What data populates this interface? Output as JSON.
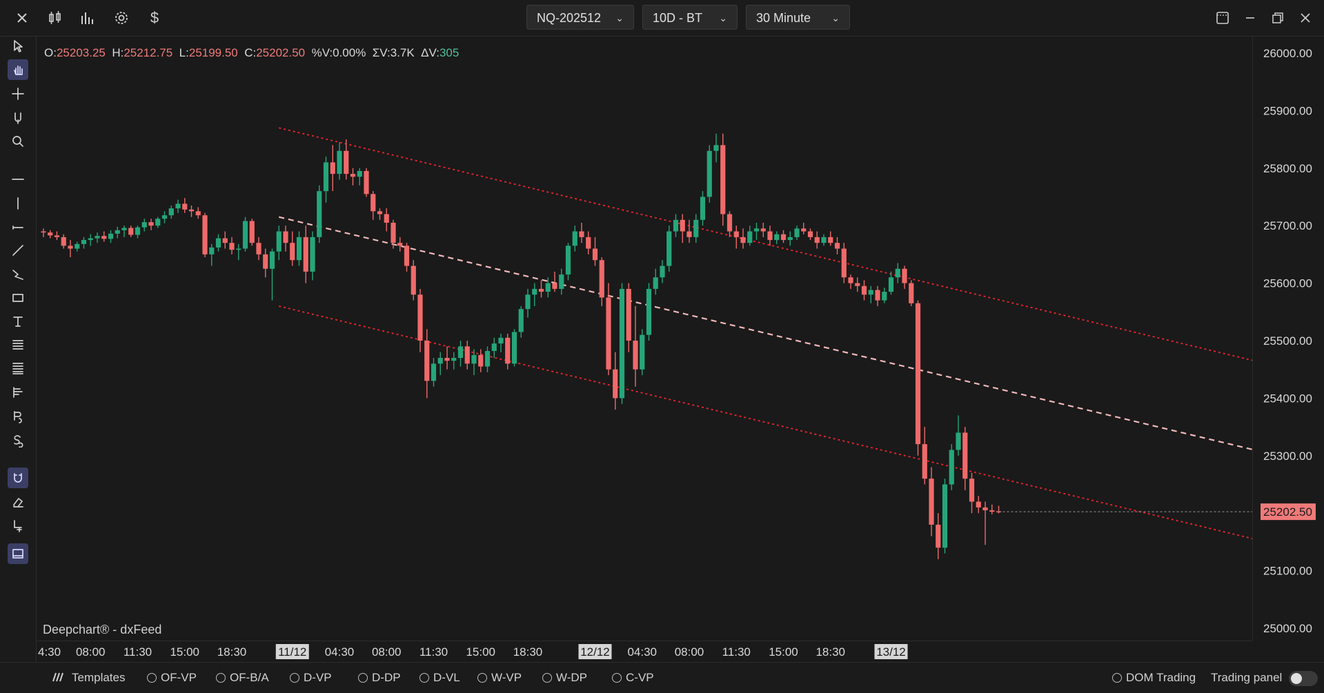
{
  "toolbar": {
    "symbol": "NQ-202512",
    "range": "10D - BT",
    "interval": "30 Minute",
    "icons": [
      "close-icon",
      "candles-icon",
      "bars-icon",
      "gear-icon",
      "dollar-icon"
    ],
    "window_icons": [
      "layout-icon",
      "minimize-icon",
      "restore-icon",
      "close-window-icon"
    ]
  },
  "ohlc": {
    "o_label": "O:",
    "o": "25203.25",
    "h_label": "H:",
    "h": "25212.75",
    "l_label": "L:",
    "l": "25199.50",
    "c_label": "C:",
    "c": "25202.50",
    "pv_label": "%V:",
    "pv": "0.00%",
    "sv_label": "ΣV:",
    "sv": "3.7K",
    "dv_label": "ΔV:",
    "dv": "305"
  },
  "watermark": "Deepchart® - dxFeed",
  "colors": {
    "up": "#26a67a",
    "down": "#f06a6a",
    "channel": "#e0242c",
    "midline": "#f2b8b8",
    "price_tag_bg": "#f07a7a",
    "active_tool": "#3b3f66"
  },
  "left_tools": [
    "cursor-icon",
    "hand-icon",
    "crosshair-icon",
    "magnet-cursor-icon",
    "zoom-icon",
    "horizontal-line-icon",
    "vertical-line-icon",
    "ray-icon",
    "trend-line-icon",
    "path-icon",
    "rectangle-icon",
    "text-icon",
    "fib-icon",
    "lines-icon",
    "volume-profile-icon",
    "buy-sell-icon",
    "session-icon",
    "magnet-icon",
    "eraser-icon",
    "add-indicator-icon",
    "panel-icon"
  ],
  "bottom": {
    "templates": "Templates",
    "studies": [
      "OF-VP",
      "OF-B/A",
      "D-VP",
      "D-DP",
      "D-VL",
      "W-VP",
      "W-DP",
      "C-VP"
    ],
    "dom_trading": "DOM Trading",
    "trading_panel": "Trading panel"
  },
  "chart_data": {
    "type": "candlestick",
    "ylim": [
      24950,
      26050
    ],
    "y_ticks": [
      "26000.00",
      "25900.00",
      "25800.00",
      "25700.00",
      "25600.00",
      "25500.00",
      "25400.00",
      "25300.00",
      "25200.00",
      "25100.00",
      "25000.00"
    ],
    "y_tick_values": [
      26000,
      25900,
      25800,
      25700,
      25600,
      25500,
      25400,
      25300,
      25200,
      25100,
      25000
    ],
    "last_price": "25202.50",
    "last_price_value": 25202.5,
    "x_ticks": [
      "4:30",
      "08:00",
      "11:30",
      "15:00",
      "18:30",
      "11/12",
      "04:30",
      "08:00",
      "11:30",
      "15:00",
      "18:30",
      "12/12",
      "04:30",
      "08:00",
      "11:30",
      "15:00",
      "18:30",
      "13/12"
    ],
    "x_tick_bar_index": [
      0,
      7,
      14,
      21,
      28,
      37,
      44,
      51,
      58,
      65,
      72,
      82,
      89,
      96,
      103,
      110,
      117,
      126
    ],
    "x_ticks_highlighted": [
      "11/12",
      "12/12",
      "13/12"
    ],
    "channel": {
      "upper": {
        "start_bar": 35,
        "start": 25870,
        "end_bar": 180,
        "end": 25465
      },
      "mid": {
        "start_bar": 35,
        "start": 25715,
        "end_bar": 180,
        "end": 25310
      },
      "lower": {
        "start_bar": 35,
        "start": 25560,
        "end_bar": 180,
        "end": 25155
      }
    },
    "candles": [
      [
        25690,
        25695,
        25680,
        25688
      ],
      [
        25688,
        25692,
        25678,
        25683
      ],
      [
        25683,
        25690,
        25675,
        25680
      ],
      [
        25680,
        25685,
        25660,
        25665
      ],
      [
        25665,
        25675,
        25645,
        25660
      ],
      [
        25660,
        25672,
        25655,
        25668
      ],
      [
        25668,
        25680,
        25660,
        25675
      ],
      [
        25675,
        25685,
        25665,
        25678
      ],
      [
        25678,
        25688,
        25670,
        25682
      ],
      [
        25682,
        25690,
        25672,
        25677
      ],
      [
        25677,
        25692,
        25670,
        25686
      ],
      [
        25686,
        25698,
        25678,
        25692
      ],
      [
        25692,
        25700,
        25680,
        25696
      ],
      [
        25696,
        25700,
        25680,
        25684
      ],
      [
        25684,
        25700,
        25678,
        25697
      ],
      [
        25697,
        25712,
        25690,
        25706
      ],
      [
        25706,
        25712,
        25692,
        25700
      ],
      [
        25700,
        25715,
        25696,
        25712
      ],
      [
        25712,
        25725,
        25704,
        25718
      ],
      [
        25718,
        25735,
        25712,
        25730
      ],
      [
        25730,
        25745,
        25722,
        25738
      ],
      [
        25738,
        25748,
        25722,
        25728
      ],
      [
        25728,
        25735,
        25715,
        25725
      ],
      [
        25725,
        25732,
        25712,
        25718
      ],
      [
        25718,
        25722,
        25645,
        25650
      ],
      [
        25650,
        25668,
        25630,
        25662
      ],
      [
        25662,
        25685,
        25655,
        25678
      ],
      [
        25678,
        25690,
        25660,
        25670
      ],
      [
        25670,
        25680,
        25650,
        25658
      ],
      [
        25658,
        25668,
        25640,
        25660
      ],
      [
        25660,
        25715,
        25655,
        25708
      ],
      [
        25708,
        25712,
        25665,
        25670
      ],
      [
        25670,
        25680,
        25640,
        25650
      ],
      [
        25650,
        25660,
        25610,
        25625
      ],
      [
        25625,
        25660,
        25570,
        25655
      ],
      [
        25655,
        25700,
        25640,
        25690
      ],
      [
        25690,
        25700,
        25655,
        25670
      ],
      [
        25670,
        25690,
        25630,
        25640
      ],
      [
        25640,
        25690,
        25630,
        25680
      ],
      [
        25680,
        25700,
        25600,
        25620
      ],
      [
        25620,
        25690,
        25605,
        25680
      ],
      [
        25680,
        25770,
        25670,
        25760
      ],
      [
        25760,
        25820,
        25740,
        25810
      ],
      [
        25810,
        25840,
        25760,
        25790
      ],
      [
        25790,
        25845,
        25780,
        25830
      ],
      [
        25830,
        25850,
        25780,
        25790
      ],
      [
        25790,
        25800,
        25770,
        25785
      ],
      [
        25785,
        25800,
        25770,
        25795
      ],
      [
        25795,
        25800,
        25750,
        25755
      ],
      [
        25755,
        25760,
        25710,
        25725
      ],
      [
        25725,
        25730,
        25710,
        25720
      ],
      [
        25720,
        25730,
        25690,
        25705
      ],
      [
        25705,
        25710,
        25660,
        25670
      ],
      [
        25670,
        25680,
        25655,
        25665
      ],
      [
        25665,
        25670,
        25620,
        25630
      ],
      [
        25630,
        25640,
        25570,
        25580
      ],
      [
        25580,
        25590,
        25480,
        25500
      ],
      [
        25500,
        25520,
        25400,
        25430
      ],
      [
        25430,
        25470,
        25420,
        25460
      ],
      [
        25460,
        25480,
        25440,
        25470
      ],
      [
        25470,
        25490,
        25450,
        25465
      ],
      [
        25465,
        25480,
        25450,
        25470
      ],
      [
        25470,
        25500,
        25455,
        25490
      ],
      [
        25490,
        25500,
        25450,
        25460
      ],
      [
        25460,
        25485,
        25440,
        25475
      ],
      [
        25475,
        25485,
        25445,
        25455
      ],
      [
        25455,
        25490,
        25445,
        25482
      ],
      [
        25482,
        25505,
        25470,
        25495
      ],
      [
        25495,
        25512,
        25480,
        25505
      ],
      [
        25505,
        25512,
        25450,
        25460
      ],
      [
        25460,
        25520,
        25455,
        25515
      ],
      [
        25515,
        25560,
        25505,
        25555
      ],
      [
        25555,
        25590,
        25540,
        25580
      ],
      [
        25580,
        25600,
        25560,
        25590
      ],
      [
        25590,
        25605,
        25575,
        25585
      ],
      [
        25585,
        25610,
        25575,
        25600
      ],
      [
        25600,
        25620,
        25585,
        25590
      ],
      [
        25590,
        25625,
        25580,
        25615
      ],
      [
        25615,
        25670,
        25605,
        25665
      ],
      [
        25665,
        25700,
        25655,
        25690
      ],
      [
        25690,
        25705,
        25670,
        25680
      ],
      [
        25680,
        25690,
        25650,
        25660
      ],
      [
        25660,
        25680,
        25630,
        25640
      ],
      [
        25640,
        25645,
        25560,
        25575
      ],
      [
        25575,
        25600,
        25440,
        25450
      ],
      [
        25450,
        25480,
        25380,
        25400
      ],
      [
        25400,
        25600,
        25390,
        25590
      ],
      [
        25590,
        25600,
        25480,
        25500
      ],
      [
        25500,
        25560,
        25420,
        25450
      ],
      [
        25450,
        25520,
        25440,
        25510
      ],
      [
        25510,
        25600,
        25500,
        25590
      ],
      [
        25590,
        25625,
        25580,
        25610
      ],
      [
        25610,
        25640,
        25600,
        25630
      ],
      [
        25630,
        25700,
        25620,
        25690
      ],
      [
        25690,
        25720,
        25680,
        25710
      ],
      [
        25710,
        25720,
        25670,
        25690
      ],
      [
        25690,
        25710,
        25670,
        25680
      ],
      [
        25680,
        25720,
        25670,
        25710
      ],
      [
        25710,
        25760,
        25700,
        25750
      ],
      [
        25750,
        25840,
        25740,
        25830
      ],
      [
        25830,
        25860,
        25810,
        25840
      ],
      [
        25840,
        25860,
        25700,
        25720
      ],
      [
        25720,
        25725,
        25680,
        25690
      ],
      [
        25690,
        25700,
        25660,
        25680
      ],
      [
        25680,
        25695,
        25660,
        25670
      ],
      [
        25670,
        25700,
        25665,
        25690
      ],
      [
        25690,
        25705,
        25675,
        25695
      ],
      [
        25695,
        25705,
        25680,
        25690
      ],
      [
        25690,
        25700,
        25665,
        25675
      ],
      [
        25675,
        25690,
        25668,
        25685
      ],
      [
        25685,
        25692,
        25670,
        25675
      ],
      [
        25675,
        25690,
        25665,
        25680
      ],
      [
        25680,
        25700,
        25675,
        25695
      ],
      [
        25695,
        25705,
        25685,
        25690
      ],
      [
        25690,
        25695,
        25675,
        25680
      ],
      [
        25680,
        25690,
        25660,
        25670
      ],
      [
        25670,
        25685,
        25665,
        25680
      ],
      [
        25680,
        25690,
        25665,
        25670
      ],
      [
        25670,
        25680,
        25650,
        25660
      ],
      [
        25660,
        25670,
        25600,
        25610
      ],
      [
        25610,
        25615,
        25590,
        25600
      ],
      [
        25600,
        25610,
        25585,
        25595
      ],
      [
        25595,
        25605,
        25570,
        25580
      ],
      [
        25580,
        25595,
        25565,
        25588
      ],
      [
        25588,
        25595,
        25560,
        25570
      ],
      [
        25570,
        25592,
        25565,
        25585
      ],
      [
        25585,
        25620,
        25580,
        25610
      ],
      [
        25610,
        25635,
        25600,
        25625
      ],
      [
        25625,
        25630,
        25590,
        25600
      ],
      [
        25600,
        25605,
        25560,
        25565
      ],
      [
        25565,
        25570,
        25300,
        25320
      ],
      [
        25320,
        25350,
        25250,
        25260
      ],
      [
        25260,
        25280,
        25160,
        25180
      ],
      [
        25180,
        25200,
        25120,
        25140
      ],
      [
        25140,
        25260,
        25130,
        25250
      ],
      [
        25250,
        25320,
        25240,
        25310
      ],
      [
        25310,
        25370,
        25300,
        25340
      ],
      [
        25340,
        25350,
        25240,
        25260
      ],
      [
        25260,
        25270,
        25200,
        25220
      ],
      [
        25220,
        25230,
        25200,
        25210
      ],
      [
        25210,
        25220,
        25145,
        25205
      ],
      [
        25205,
        25215,
        25198,
        25202.5
      ],
      [
        25203.25,
        25212.75,
        25199.5,
        25202.5
      ]
    ]
  }
}
